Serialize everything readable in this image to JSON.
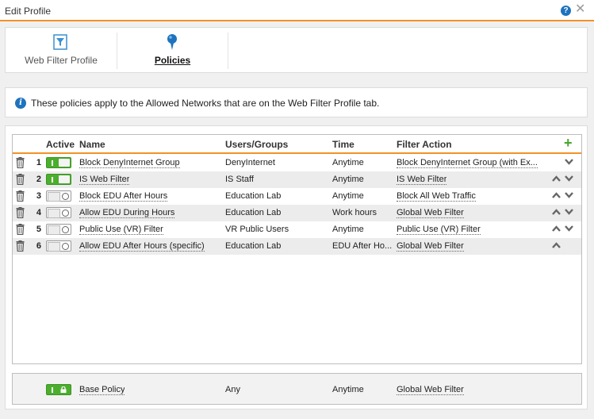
{
  "window": {
    "title": "Edit Profile",
    "help_icon": "?",
    "close_icon": "✕"
  },
  "tabs": [
    {
      "label": "Web Filter Profile",
      "icon": "filter-icon",
      "active": false
    },
    {
      "label": "Policies",
      "icon": "pin-icon",
      "active": true
    }
  ],
  "info": {
    "text": "These policies apply to the Allowed Networks that are on the Web Filter Profile tab."
  },
  "grid": {
    "headers": {
      "active": "Active",
      "name": "Name",
      "users": "Users/Groups",
      "time": "Time",
      "action": "Filter Action"
    },
    "add_icon": "+",
    "rows": [
      {
        "num": "1",
        "active": true,
        "name": "Block DenyInternet Group",
        "users": "DenyInternet",
        "time": "Anytime",
        "action": "Block DenyInternet Group (with Ex...",
        "up": false,
        "down": true
      },
      {
        "num": "2",
        "active": true,
        "name": "IS Web Filter",
        "users": "IS Staff",
        "time": "Anytime",
        "action": "IS Web Filter",
        "up": true,
        "down": true
      },
      {
        "num": "3",
        "active": false,
        "name": "Block EDU After Hours",
        "users": "Education Lab",
        "time": "Anytime",
        "action": "Block All Web Traffic",
        "up": true,
        "down": true
      },
      {
        "num": "4",
        "active": false,
        "name": "Allow EDU During Hours",
        "users": "Education Lab",
        "time": "Work hours",
        "action": "Global Web Filter",
        "up": true,
        "down": true
      },
      {
        "num": "5",
        "active": false,
        "name": "Public Use (VR) Filter",
        "users": "VR Public Users",
        "time": "Anytime",
        "action": "Public Use (VR) Filter",
        "up": true,
        "down": true
      },
      {
        "num": "6",
        "active": false,
        "name": "Allow EDU After Hours (specific)",
        "users": "Education Lab",
        "time": "EDU After Ho...",
        "action": "Global Web Filter",
        "up": true,
        "down": false
      }
    ]
  },
  "base_policy": {
    "name": "Base Policy",
    "users": "Any",
    "time": "Anytime",
    "action": "Global Web Filter",
    "locked": true
  }
}
